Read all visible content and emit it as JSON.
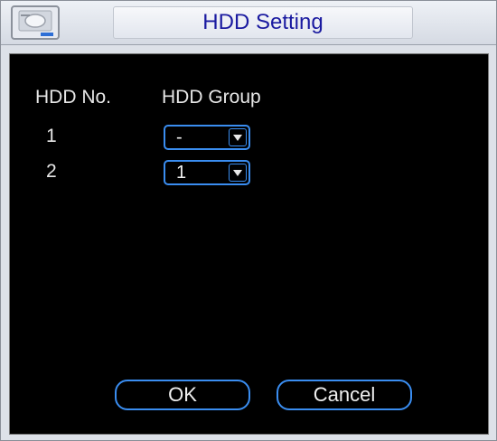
{
  "window": {
    "title": "HDD Setting"
  },
  "table": {
    "col_hdd_no": "HDD No.",
    "col_hdd_group": "HDD Group",
    "rows": [
      {
        "hdd_no": "1",
        "group": "-"
      },
      {
        "hdd_no": "2",
        "group": "1"
      }
    ]
  },
  "buttons": {
    "ok": "OK",
    "cancel": "Cancel"
  },
  "colors": {
    "accent": "#3a8df0",
    "title": "#1a1aa0",
    "panel": "#000000"
  },
  "icons": {
    "header": "hdd-icon",
    "dropdown": "chevron-down-icon"
  }
}
